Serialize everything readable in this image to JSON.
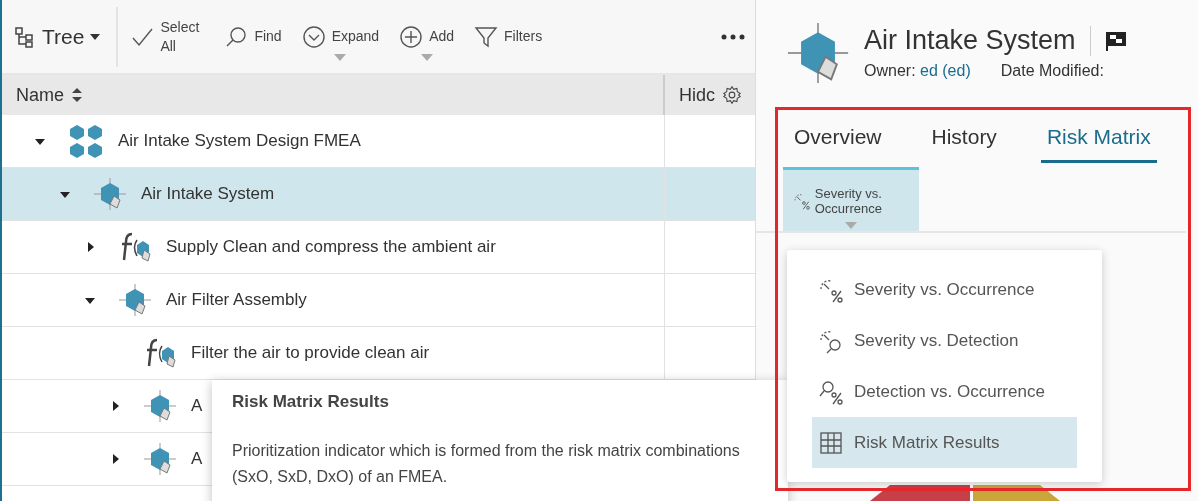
{
  "toolbar": {
    "view": {
      "label": "Tree"
    },
    "actions": [
      {
        "label": "Select All",
        "kind": "check"
      },
      {
        "label": "Find",
        "kind": "find"
      },
      {
        "label": "Expand",
        "kind": "expand",
        "dropdown": true
      },
      {
        "label": "Add",
        "kind": "add",
        "dropdown": true
      },
      {
        "label": "Filters",
        "kind": "filter"
      }
    ]
  },
  "table": {
    "columns": [
      {
        "label": "Name",
        "kind": "name"
      },
      {
        "label": "Hidc",
        "kind": "settings"
      }
    ],
    "rows": [
      {
        "name": "Air Intake System Design FMEA",
        "kind": "fmea",
        "expanded": true,
        "selected": false,
        "children": [
          {
            "name": "Air Intake System",
            "kind": "system",
            "expanded": true,
            "selected": true,
            "children": [
              {
                "name": "Supply Clean and compress the ambient air",
                "kind": "function",
                "expanded": false,
                "selected": false
              },
              {
                "name": "Air Filter Assembly",
                "kind": "system",
                "expanded": true,
                "selected": false,
                "children": [
                  {
                    "name": "Filter the air to provide clean air",
                    "kind": "function",
                    "selected": false
                  },
                  {
                    "name": "A",
                    "kind": "system",
                    "expanded": false,
                    "selected": false
                  },
                  {
                    "name": "A",
                    "kind": "system",
                    "expanded": false,
                    "selected": false
                  }
                ]
              }
            ]
          }
        ]
      }
    ]
  },
  "tooltip": {
    "title": "Risk Matrix Results",
    "text": "Prioritization indicator which is formed from the risk matrix combinations (SxO, SxD, DxO) of an FMEA."
  },
  "detail": {
    "title": "Air Intake System",
    "owner_label": "Owner:",
    "owner": "ed (ed)",
    "date_label": "Date Modified:",
    "tabs": [
      {
        "label": "Overview",
        "selected": false
      },
      {
        "label": "History",
        "selected": false
      },
      {
        "label": "Risk Matrix",
        "selected": true
      }
    ],
    "view_button": {
      "label": "Severity vs. Occurrence",
      "kind": "sxo"
    },
    "menu": [
      {
        "label": "Severity vs. Occurrence",
        "kind": "sxo",
        "selected": false
      },
      {
        "label": "Severity vs. Detection",
        "kind": "sxd",
        "selected": false
      },
      {
        "label": "Detection vs. Occurrence",
        "kind": "dxo",
        "selected": false
      },
      {
        "label": "Risk Matrix Results",
        "kind": "results",
        "selected": true
      }
    ]
  }
}
